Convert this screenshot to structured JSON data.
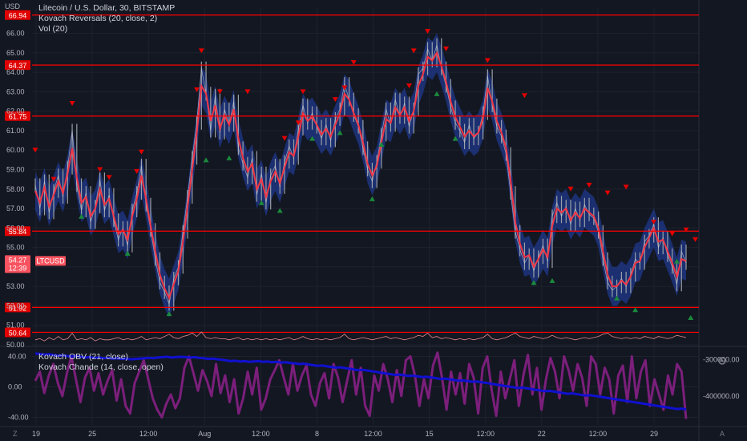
{
  "header": {
    "unit": "USD",
    "title": "Litecoin / U.S. Dollar, 30, BITSTAMP",
    "indicator_1": "Kovach Reversals (20, close, 2)",
    "indicator_2": "Vol (20)"
  },
  "lower_pane": {
    "legend_1": "Kovach OBV (21, close)",
    "legend_2": "Kovach Chande (14, close, open)"
  },
  "corners": {
    "left": "Z",
    "right": "A",
    "settings_icon": "gear-icon"
  },
  "price_tag": {
    "symbol": "LTCUSD",
    "price": "54.27",
    "countdown": "12:39"
  },
  "colors": {
    "background": "#131722",
    "grid": "#1e222d",
    "price_candle": "#9aa0a8",
    "band_fill": "#1f3a93",
    "reversal_line": "#f23645",
    "level_line": "#ff0000",
    "down_marker": "#e00000",
    "up_marker": "#1b8a3c",
    "volume_line": "#e08a8a",
    "obv_line": "#1010d0",
    "chande_line": "#7b1f7b"
  },
  "chart_data": [
    {
      "type": "line",
      "title": "Litecoin / U.S. Dollar, 30, BITSTAMP",
      "ylabel": "USD",
      "ylim": [
        50,
        67.3
      ],
      "y_ticks": [
        "50.00",
        "51.00",
        "52.00",
        "53.00",
        "54.00",
        "55.00",
        "56.00",
        "57.00",
        "58.00",
        "59.00",
        "60.00",
        "61.00",
        "62.00",
        "63.00",
        "64.00",
        "65.00",
        "66.00"
      ],
      "x_ticks": [
        "19",
        "25",
        "12:00",
        "Aug",
        "12:00",
        "8",
        "12:00",
        "15",
        "12:00",
        "22",
        "12:00",
        "29"
      ],
      "horizontal_levels": [
        66.94,
        64.37,
        61.75,
        55.84,
        51.92,
        50.64
      ],
      "series": [
        {
          "name": "LTCUSD",
          "values": [
            58.2,
            57.0,
            58.4,
            56.8,
            57.9,
            58.7,
            57.6,
            59.1,
            61.0,
            58.2,
            56.9,
            57.8,
            56.3,
            57.1,
            58.5,
            56.9,
            57.7,
            56.4,
            55.4,
            56.0,
            55.1,
            56.9,
            57.8,
            59.2,
            57.2,
            55.9,
            54.4,
            53.2,
            52.7,
            52.1,
            53.4,
            54.0,
            55.8,
            57.6,
            59.6,
            61.4,
            64.2,
            62.9,
            61.0,
            62.8,
            60.9,
            62.1,
            61.3,
            62.5,
            60.1,
            59.3,
            58.6,
            59.6,
            57.7,
            58.8,
            57.3,
            58.7,
            59.2,
            58.1,
            59.4,
            60.2,
            59.6,
            61.1,
            62.3,
            61.4,
            61.9,
            61.2,
            60.6,
            61.3,
            60.5,
            61.6,
            62.1,
            63.4,
            62.6,
            61.8,
            61.2,
            60.1,
            59.0,
            58.4,
            59.4,
            60.8,
            62.1,
            61.3,
            62.6,
            61.7,
            62.4,
            61.2,
            62.1,
            63.9,
            64.2,
            65.2,
            64.6,
            65.4,
            64.2,
            63.3,
            62.2,
            61.4,
            61.0,
            60.4,
            61.3,
            60.6,
            60.9,
            61.9,
            63.8,
            62.3,
            61.2,
            60.7,
            59.8,
            57.8,
            55.8,
            54.9,
            54.2,
            54.6,
            53.8,
            54.5,
            55.1,
            54.3,
            56.6,
            57.3,
            56.6,
            57.1,
            56.2,
            57.0,
            56.4,
            57.2,
            56.7,
            56.5,
            55.8,
            54.4,
            53.2,
            52.8,
            53.0,
            53.4,
            53.0,
            53.6,
            54.4,
            54.2,
            55.3,
            55.6,
            56.2,
            55.0,
            55.5,
            54.6,
            54.0,
            53.1,
            54.8,
            54.2
          ]
        },
        {
          "name": "Kovach Reversals (20, close, 2)",
          "values": [
            57.9,
            57.3,
            58.1,
            57.1,
            57.7,
            58.4,
            57.8,
            58.8,
            60.1,
            58.6,
            57.3,
            57.6,
            56.6,
            57.0,
            58.0,
            57.2,
            57.5,
            56.6,
            55.7,
            55.9,
            55.4,
            56.6,
            57.5,
            58.7,
            57.5,
            56.1,
            54.8,
            53.6,
            52.9,
            52.4,
            53.1,
            53.8,
            55.3,
            57.1,
            59.0,
            60.9,
            63.3,
            62.9,
            61.5,
            62.3,
            61.1,
            61.8,
            61.3,
            62.1,
            60.6,
            59.6,
            58.9,
            59.3,
            58.0,
            58.5,
            57.6,
            58.4,
            58.9,
            58.3,
            59.1,
            59.9,
            59.7,
            60.7,
            61.9,
            61.5,
            61.7,
            61.3,
            60.8,
            61.1,
            60.7,
            61.3,
            61.9,
            62.9,
            62.6,
            61.9,
            61.3,
            60.4,
            59.3,
            58.7,
            59.2,
            60.4,
            61.6,
            61.4,
            62.2,
            61.8,
            62.2,
            61.5,
            62.0,
            63.3,
            63.9,
            64.8,
            64.6,
            65.0,
            64.3,
            63.5,
            62.5,
            61.7,
            61.2,
            60.7,
            61.0,
            60.7,
            60.9,
            61.6,
            63.2,
            62.5,
            61.5,
            60.9,
            60.1,
            58.4,
            56.3,
            55.2,
            54.5,
            54.6,
            54.0,
            54.4,
            54.9,
            54.5,
            56.1,
            57.0,
            56.8,
            57.0,
            56.4,
            56.8,
            56.5,
            57.0,
            56.8,
            56.6,
            56.0,
            54.8,
            53.6,
            53.0,
            53.0,
            53.3,
            53.1,
            53.5,
            54.2,
            54.3,
            55.0,
            55.5,
            56.0,
            55.3,
            55.4,
            54.8,
            54.2,
            53.5,
            54.4,
            54.3
          ]
        }
      ],
      "down_markers": [
        [
          0,
          60.0
        ],
        [
          4,
          58.5
        ],
        [
          8,
          62.4
        ],
        [
          14,
          59.0
        ],
        [
          16,
          58.6
        ],
        [
          22,
          58.9
        ],
        [
          23,
          59.9
        ],
        [
          35,
          63.1
        ],
        [
          36,
          65.1
        ],
        [
          40,
          63.0
        ],
        [
          46,
          63.0
        ],
        [
          54,
          60.6
        ],
        [
          57,
          61.4
        ],
        [
          58,
          63.0
        ],
        [
          65,
          62.6
        ],
        [
          67,
          63.2
        ],
        [
          69,
          64.5
        ],
        [
          81,
          63.3
        ],
        [
          82,
          65.1
        ],
        [
          85,
          66.1
        ],
        [
          89,
          65.2
        ],
        [
          98,
          64.6
        ],
        [
          106,
          62.8
        ],
        [
          116,
          58.0
        ],
        [
          120,
          58.2
        ],
        [
          124,
          57.8
        ],
        [
          128,
          58.1
        ],
        [
          134,
          56.3
        ],
        [
          138,
          55.7
        ],
        [
          141,
          55.9
        ],
        [
          143,
          55.4
        ]
      ],
      "up_markers": [
        [
          10,
          56.6
        ],
        [
          20,
          54.7
        ],
        [
          29,
          51.6
        ],
        [
          37,
          59.5
        ],
        [
          42,
          59.6
        ],
        [
          49,
          57.3
        ],
        [
          53,
          56.9
        ],
        [
          60,
          60.6
        ],
        [
          66,
          60.9
        ],
        [
          73,
          57.5
        ],
        [
          75,
          60.3
        ],
        [
          87,
          62.9
        ],
        [
          91,
          60.6
        ],
        [
          108,
          53.2
        ],
        [
          112,
          53.3
        ],
        [
          126,
          52.4
        ],
        [
          130,
          51.8
        ],
        [
          139,
          54.3
        ],
        [
          142,
          51.4
        ]
      ],
      "volume": [
        0.3,
        0.4,
        0.2,
        0.5,
        0.3,
        0.6,
        0.3,
        0.4,
        0.9,
        0.3,
        0.4,
        0.3,
        0.5,
        0.2,
        0.4,
        0.3,
        0.3,
        0.4,
        0.5,
        0.3,
        0.4,
        0.3,
        0.4,
        0.6,
        0.3,
        0.4,
        0.5,
        0.4,
        0.6,
        0.8,
        0.5,
        0.4,
        0.6,
        0.7,
        0.9,
        0.6,
        1.0,
        0.5,
        0.4,
        0.5,
        0.4,
        0.4,
        0.3,
        0.4,
        0.5,
        0.3,
        0.4,
        0.3,
        0.4,
        0.3,
        0.4,
        0.3,
        0.4,
        0.3,
        0.4,
        0.5,
        0.3,
        0.4,
        0.6,
        0.4,
        0.3,
        0.4,
        0.3,
        0.4,
        0.3,
        0.4,
        0.5,
        0.8,
        0.4,
        0.3,
        0.4,
        0.5,
        0.4,
        0.3,
        0.4,
        0.5,
        0.6,
        0.4,
        0.5,
        0.4,
        0.3,
        0.4,
        0.5,
        0.7,
        0.6,
        0.9,
        0.5,
        0.6,
        0.4,
        0.5,
        0.4,
        0.3,
        0.4,
        0.3,
        0.4,
        0.3,
        0.4,
        0.5,
        0.8,
        0.4,
        0.3,
        0.4,
        0.5,
        0.7,
        0.9,
        0.6,
        0.5,
        0.4,
        0.6,
        0.5,
        0.4,
        0.5,
        0.7,
        0.5,
        0.4,
        0.5,
        0.4,
        0.3,
        0.4,
        0.5,
        0.4,
        0.5,
        0.6,
        0.8,
        0.9,
        0.6,
        0.5,
        0.4,
        0.5,
        0.4,
        0.5,
        0.4,
        0.6,
        0.5,
        0.4,
        0.6,
        0.5,
        0.4,
        0.5,
        0.7,
        0.6,
        0.5
      ]
    },
    {
      "type": "line",
      "ylim": [
        -50,
        50
      ],
      "y_ticks": [
        "40.00",
        "0.00",
        "-40.00"
      ],
      "right_ticks": [
        "-300000.00",
        "-400000.00"
      ],
      "right_ylim": [
        -480000,
        -270000
      ],
      "series": [
        {
          "name": "Kovach Chande (14, close, open)",
          "values": [
            8,
            20,
            -8,
            15,
            30,
            5,
            -12,
            18,
            40,
            10,
            -20,
            12,
            25,
            -5,
            18,
            -10,
            8,
            22,
            -18,
            10,
            -25,
            -35,
            5,
            20,
            35,
            10,
            -15,
            -30,
            -40,
            -22,
            -10,
            -28,
            -15,
            25,
            40,
            18,
            -5,
            22,
            8,
            -12,
            30,
            -8,
            15,
            -20,
            10,
            -35,
            -15,
            20,
            -10,
            25,
            -30,
            -15,
            10,
            22,
            35,
            12,
            -10,
            30,
            -5,
            15,
            28,
            -10,
            -25,
            5,
            18,
            -15,
            30,
            12,
            -20,
            8,
            35,
            -10,
            25,
            -25,
            -38,
            15,
            -5,
            30,
            10,
            -20,
            22,
            -12,
            35,
            40,
            15,
            -25,
            10,
            -15,
            28,
            45,
            12,
            -30,
            20,
            -10,
            18,
            -22,
            30,
            12,
            -35,
            25,
            40,
            -5,
            -38,
            20,
            -15,
            10,
            35,
            -25,
            15,
            42,
            -10,
            25,
            -30,
            10,
            38,
            20,
            -15,
            40,
            22,
            -5,
            30,
            12,
            -25,
            40,
            30,
            -10,
            25,
            10,
            -35,
            15,
            28,
            -20,
            40,
            -15,
            20,
            35,
            -25,
            10,
            -10,
            -30,
            15,
            -10,
            30,
            20,
            -42
          ]
        },
        {
          "name": "Kovach OBV (21, close)",
          "values": [
            -283000,
            -284000,
            -286000,
            -285000,
            -287000,
            -289000,
            -288000,
            -290000,
            -291000,
            -290000,
            -292000,
            -294000,
            -293000,
            -295000,
            -294000,
            -296000,
            -295000,
            -297000,
            -296000,
            -298000,
            -297000,
            -299000,
            -298000,
            -297000,
            -296000,
            -295000,
            -296000,
            -294000,
            -293000,
            -292000,
            -294000,
            -293000,
            -292000,
            -293000,
            -294000,
            -293000,
            -295000,
            -296000,
            -298000,
            -297000,
            -299000,
            -300000,
            -302000,
            -304000,
            -303000,
            -305000,
            -304000,
            -306000,
            -305000,
            -304000,
            -306000,
            -305000,
            -307000,
            -306000,
            -308000,
            -307000,
            -309000,
            -310000,
            -312000,
            -311000,
            -313000,
            -315000,
            -317000,
            -316000,
            -318000,
            -320000,
            -322000,
            -321000,
            -323000,
            -325000,
            -327000,
            -329000,
            -328000,
            -330000,
            -332000,
            -334000,
            -336000,
            -338000,
            -340000,
            -342000,
            -341000,
            -343000,
            -345000,
            -344000,
            -346000,
            -348000,
            -347000,
            -349000,
            -351000,
            -353000,
            -352000,
            -354000,
            -356000,
            -358000,
            -357000,
            -359000,
            -361000,
            -360000,
            -362000,
            -364000,
            -366000,
            -368000,
            -370000,
            -372000,
            -374000,
            -376000,
            -378000,
            -377000,
            -379000,
            -381000,
            -383000,
            -385000,
            -387000,
            -386000,
            -388000,
            -390000,
            -392000,
            -394000,
            -393000,
            -395000,
            -397000,
            -399000,
            -398000,
            -400000,
            -402000,
            -404000,
            -406000,
            -408000,
            -410000,
            -412000,
            -414000,
            -416000,
            -418000,
            -420000,
            -422000,
            -424000,
            -426000,
            -428000,
            -430000,
            -432000,
            -434000,
            -436000,
            -435000,
            -437000
          ]
        }
      ]
    }
  ]
}
